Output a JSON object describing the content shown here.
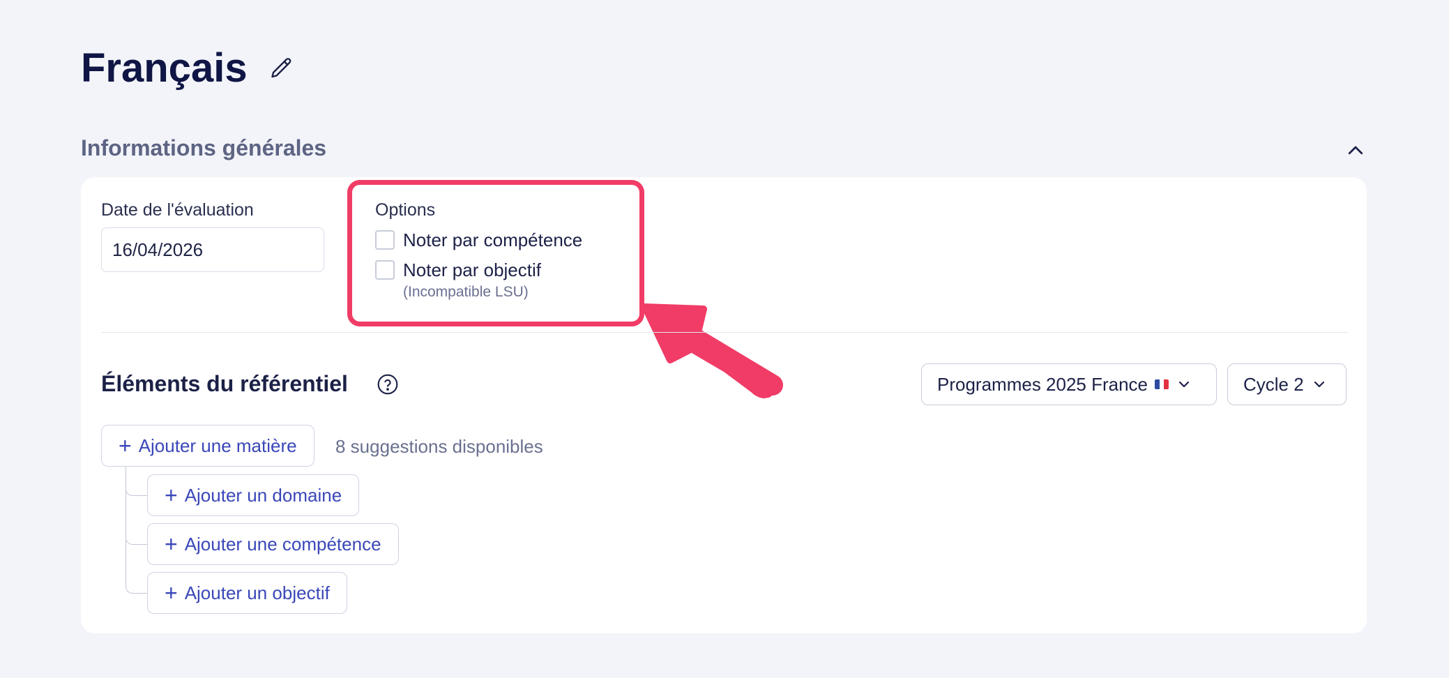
{
  "page": {
    "title": "Français"
  },
  "general_section": {
    "title": "Informations générales",
    "date_label": "Date de l'évaluation",
    "date_value": "16/04/2026",
    "options_label": "Options",
    "options": [
      {
        "label": "Noter par compétence",
        "checked": false
      },
      {
        "label": "Noter par objectif",
        "checked": false,
        "note": "(Incompatible LSU)"
      }
    ]
  },
  "referentiel": {
    "title": "Éléments du référentiel",
    "program_select": "Programmes 2025 France",
    "cycle_select": "Cycle 2",
    "add_matiere": "Ajouter une matière",
    "suggestions": "8 suggestions disponibles",
    "add_domaine": "Ajouter un domaine",
    "add_competence": "Ajouter une compétence",
    "add_objectif": "Ajouter un objectif"
  },
  "icons": {
    "edit": "pencil-icon",
    "collapse": "chevron-up-icon",
    "help": "help-circle-icon",
    "dropdown": "chevron-down-icon",
    "add": "plus-icon",
    "flag": "france-flag-icon"
  },
  "colors": {
    "background": "#f3f4f9",
    "card": "#ffffff",
    "title": "#0f1544",
    "accent": "#3a47b8",
    "highlight": "#f03c66",
    "muted": "#6a7090"
  }
}
